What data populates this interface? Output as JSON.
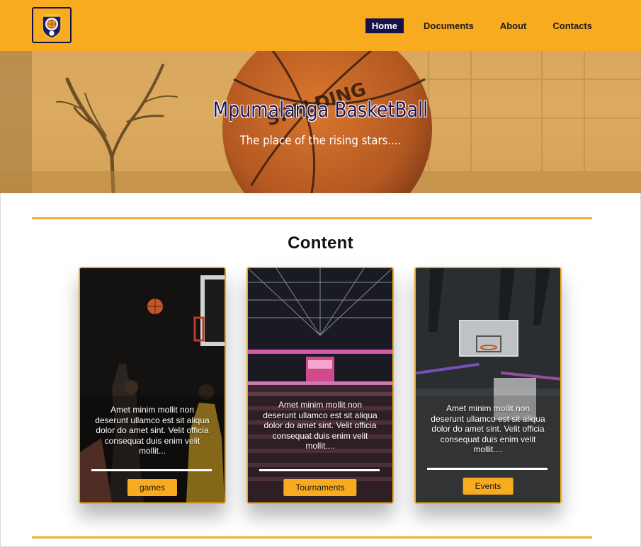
{
  "nav": {
    "items": [
      {
        "label": "Home",
        "active": true
      },
      {
        "label": "Documents",
        "active": false
      },
      {
        "label": "About",
        "active": false
      },
      {
        "label": "Contacts",
        "active": false
      }
    ]
  },
  "logo": {
    "icon": "basketball-crest-icon"
  },
  "hero": {
    "title": "Mpumalanga BasketBall",
    "subtitle": "The place of the rising stars...."
  },
  "content": {
    "title": "Content",
    "cards": [
      {
        "text": "Amet minim mollit non deserunt ullamco est sit aliqua dolor do amet sint. Velit officia consequat duis enim velit mollit...",
        "button": "games"
      },
      {
        "text": "Amet minim mollit non deserunt ullamco est sit aliqua dolor do amet sint. Velit officia consequat duis enim velit mollit....",
        "button": "Tournaments"
      },
      {
        "text": "Amet minim mollit non deserunt ullamco est sit aliqua dolor do amet sint. Velit officia consequat duis enim velit mollit....",
        "button": "Events"
      }
    ]
  },
  "colors": {
    "accent": "#f9ab1f",
    "navy": "#17114a"
  }
}
